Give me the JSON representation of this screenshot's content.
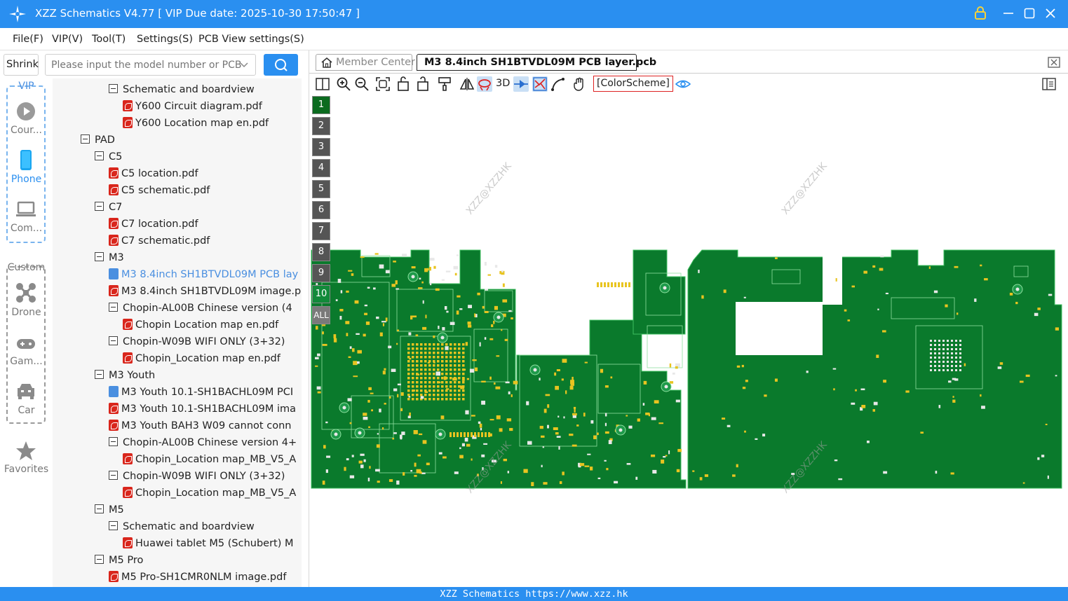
{
  "window": {
    "title": "XZZ Schematics V4.77 [ VIP Due date: 2025-10-30 17:50:47 ]",
    "accent_color": "#2a8ff0"
  },
  "menu": [
    "File(F)",
    "VIP(V)",
    "Tool(T)",
    "Settings(S)",
    "PCB View settings(S)"
  ],
  "search": {
    "shrink_label": "Shrink",
    "placeholder": "Please input the model number or PCB"
  },
  "leftnav": {
    "vip_label": "VIP",
    "vip_items": [
      "Cour...",
      "Phone",
      "Com..."
    ],
    "custom_label": "Custom",
    "custom_items": [
      "Drone",
      "Gam...",
      "Car"
    ],
    "favorites_label": "Favorites"
  },
  "tree": [
    {
      "label": "Schematic and boardview",
      "kind": "folder",
      "depth": 2
    },
    {
      "label": "Y600 Circuit diagram.pdf",
      "kind": "pdf",
      "depth": 3
    },
    {
      "label": "Y600 Location map en.pdf",
      "kind": "pdf",
      "depth": 3
    },
    {
      "label": "PAD",
      "kind": "folder",
      "depth": 0
    },
    {
      "label": "C5",
      "kind": "folder",
      "depth": 1
    },
    {
      "label": "C5 location.pdf",
      "kind": "pdf",
      "depth": 2
    },
    {
      "label": "C5 schematic.pdf",
      "kind": "pdf",
      "depth": 2
    },
    {
      "label": "C7",
      "kind": "folder",
      "depth": 1
    },
    {
      "label": "C7 location.pdf",
      "kind": "pdf",
      "depth": 2
    },
    {
      "label": "C7 schematic.pdf",
      "kind": "pdf",
      "depth": 2
    },
    {
      "label": "M3",
      "kind": "folder",
      "depth": 1
    },
    {
      "label": "M3 8.4inch SH1BTVDL09M PCB lay",
      "kind": "pcb",
      "depth": 2,
      "selected": true
    },
    {
      "label": "M3 8.4inch SH1BTVDL09M image.p",
      "kind": "pdf",
      "depth": 2
    },
    {
      "label": "Chopin-AL00B  Chinese version  (4",
      "kind": "folder",
      "depth": 2
    },
    {
      "label": "Chopin Location map en.pdf",
      "kind": "pdf",
      "depth": 3
    },
    {
      "label": "Chopin-W09B  WIFI ONLY  (3+32)",
      "kind": "folder",
      "depth": 2
    },
    {
      "label": "Chopin_Location map en.pdf",
      "kind": "pdf",
      "depth": 3
    },
    {
      "label": "M3 Youth",
      "kind": "folder",
      "depth": 1
    },
    {
      "label": "M3 Youth 10.1-SH1BACHL09M PCI",
      "kind": "pcb",
      "depth": 2
    },
    {
      "label": "M3 Youth 10.1-SH1BACHL09M ima",
      "kind": "pdf",
      "depth": 2
    },
    {
      "label": "M3 Youth BAH3 W09 cannot conn",
      "kind": "pdf",
      "depth": 2
    },
    {
      "label": "Chopin-AL00B  Chinese version 4+",
      "kind": "folder",
      "depth": 2
    },
    {
      "label": "Chopin_Location map_MB_V5_A",
      "kind": "pdf",
      "depth": 3
    },
    {
      "label": "Chopin-W09B  WIFI ONLY  (3+32)",
      "kind": "folder",
      "depth": 2
    },
    {
      "label": "Chopin_Location map_MB_V5_A",
      "kind": "pdf",
      "depth": 3
    },
    {
      "label": "M5",
      "kind": "folder",
      "depth": 1
    },
    {
      "label": "Schematic and boardview",
      "kind": "folder",
      "depth": 2
    },
    {
      "label": "Huawei tablet M5 (Schubert) M",
      "kind": "pdf",
      "depth": 3
    },
    {
      "label": "M5 Pro",
      "kind": "folder",
      "depth": 1
    },
    {
      "label": "M5 Pro-SH1CMR0NLM image.pdf",
      "kind": "pdf",
      "depth": 2
    }
  ],
  "tabs": {
    "member": "Member Center",
    "active": "M3 8.4inch SH1BTVDL09M PCB layer.pcb"
  },
  "toolbar": {
    "label_3d": "3D",
    "color_scheme": "[ColorScheme]",
    "icons": [
      "split-view-icon",
      "zoom-in-icon",
      "zoom-out-icon",
      "fit-screen-icon",
      "rotate-left-icon",
      "rotate-right-icon",
      "paint-icon",
      "flip-icon",
      "net-highlight-icon",
      "3d-icon",
      "probe-icon",
      "trace-icon",
      "route-icon",
      "hand-icon",
      "color-scheme",
      "eye-icon"
    ]
  },
  "layers": [
    "1",
    "2",
    "3",
    "4",
    "5",
    "6",
    "7",
    "8",
    "9",
    "10",
    "ALL"
  ],
  "layer_active": "1",
  "watermark": "XZZ@XZZHK",
  "status": "XZZ Schematics https://www.xzz.hk",
  "colors": {
    "pcb_green": "#0a7a2c",
    "pad_yellow": "#e8c420",
    "tree_bg": "#f6f6f6"
  }
}
